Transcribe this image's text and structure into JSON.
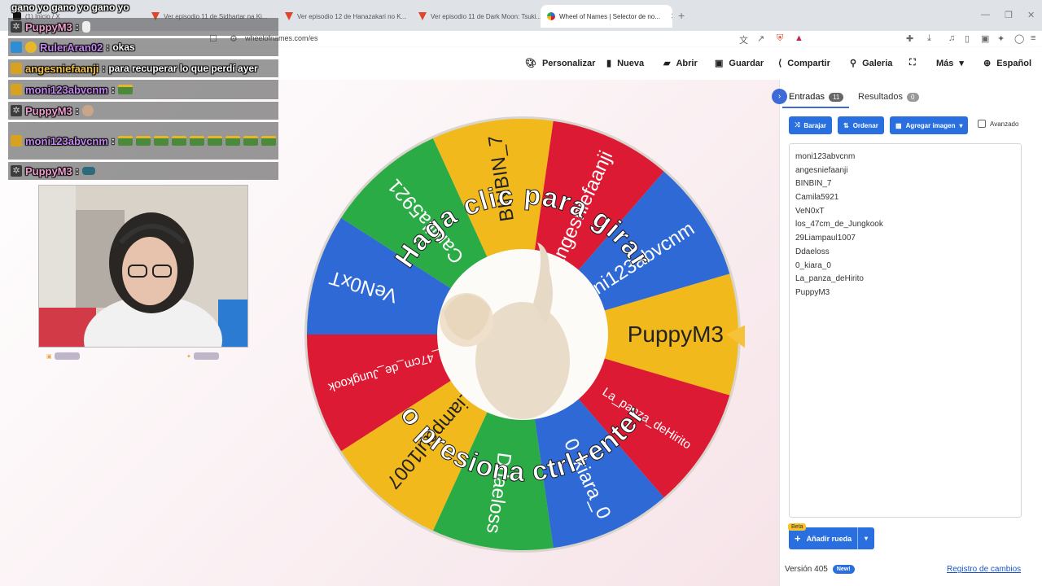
{
  "browser": {
    "tabs": [
      {
        "title": "(1) Inicio / X",
        "icon": "x-icon"
      },
      {
        "title": "Ver episodio 11 de Sidhartar na Ki...",
        "icon": "anime-icon"
      },
      {
        "title": "Ver episodio 12 de Hanazakari no K...",
        "icon": "anime-icon"
      },
      {
        "title": "Ver episodio 11 de Dark Moon: Tsuki...",
        "icon": "anime-icon"
      },
      {
        "title": "Wheel of Names | Selector de no...",
        "icon": "wheel-icon",
        "active": true
      }
    ],
    "url": "wheelofnames.com/es"
  },
  "nav": {
    "customize": "Personalizar",
    "new": "Nueva",
    "open": "Abrir",
    "save": "Guardar",
    "share": "Compartir",
    "gallery": "Galeria",
    "more": "Más",
    "language": "Español"
  },
  "wheel": {
    "instruction_top": "Haga clic para girar",
    "instruction_bottom": "o presiona ctrl+enter",
    "segments": [
      {
        "label": "PuppyM3",
        "color": "#f2b91c"
      },
      {
        "label": "La_panza_deHirito",
        "color": "#dd1a33"
      },
      {
        "label": "0_kiara_0",
        "color": "#2f69d6"
      },
      {
        "label": "Ddaeloss",
        "color": "#2bab45"
      },
      {
        "label": "29Liampaul1007",
        "color": "#f2b91c"
      },
      {
        "label": "los_47cm_de_Jungkook",
        "color": "#dd1a33"
      },
      {
        "label": "VeN0xT",
        "color": "#2f69d6"
      },
      {
        "label": "Camila5921",
        "color": "#2bab45"
      },
      {
        "label": "BINBIN_7",
        "color": "#f2b91c"
      },
      {
        "label": "angesniefaanji",
        "color": "#dd1a33"
      },
      {
        "label": "moni123abvcnm",
        "color": "#2f69d6"
      }
    ]
  },
  "panel": {
    "tab_entries": "Entradas",
    "entries_count": "11",
    "tab_results": "Resultados",
    "results_count": "0",
    "shuffle": "Barajar",
    "sort": "Ordenar",
    "add_image": "Agregar imagen",
    "advanced": "Avanzado",
    "entries": [
      "moni123abvcnm",
      "angesniefaanji",
      "BINBIN_7",
      "Camila5921",
      "VeN0xT",
      "los_47cm_de_Jungkook",
      "29Liampaul1007",
      "Ddaeloss",
      "0_kiara_0",
      "La_panza_deHirito",
      "PuppyM3"
    ],
    "beta": "Beta",
    "add_wheel": "Añadir rueda",
    "version": "Versión 405",
    "new_badge": "New!",
    "changelog": "Registro de cambios"
  },
  "chat": {
    "top_line": "gano yo gano yo gano yo",
    "messages": [
      {
        "user": "PuppyM3",
        "text": ""
      },
      {
        "user": "RulerAran02",
        "text": "okas"
      },
      {
        "user": "angesniefaanji",
        "text": "para recuperar lo que perdí ayer"
      },
      {
        "user": "moni123abvcnm",
        "text": ""
      },
      {
        "user": "PuppyM3",
        "text": ""
      },
      {
        "user": "moni123abvcnm",
        "text": ""
      },
      {
        "user": "PuppyM3",
        "text": ""
      }
    ]
  }
}
